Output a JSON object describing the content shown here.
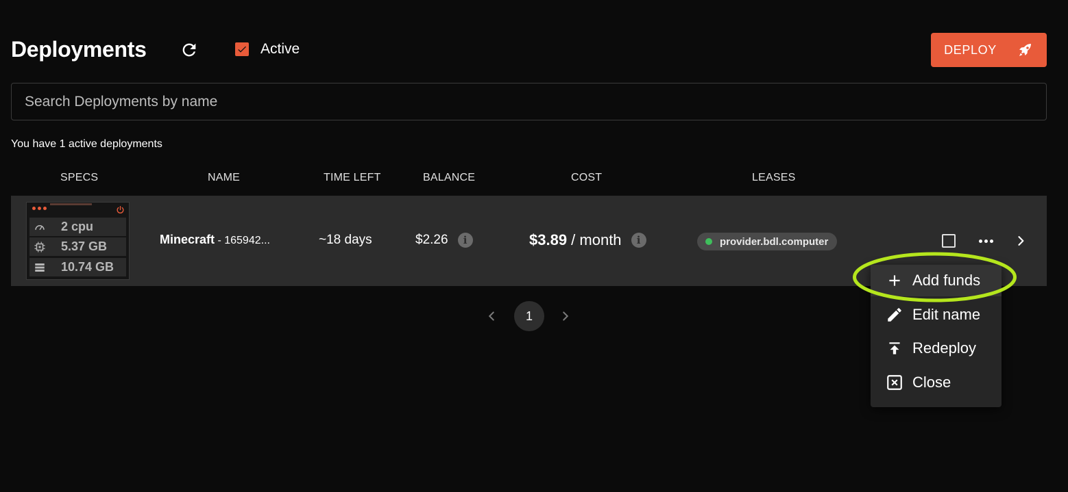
{
  "header": {
    "title": "Deployments",
    "filter_label": "Active",
    "filter_checked": true,
    "deploy_label": "DEPLOY"
  },
  "search": {
    "placeholder": "Search Deployments by name",
    "value": ""
  },
  "summary_text": "You have 1 active deployments",
  "columns": [
    "SPECS",
    "NAME",
    "TIME LEFT",
    "BALANCE",
    "COST",
    "LEASES"
  ],
  "deployment": {
    "specs": {
      "cpu": "2 cpu",
      "memory": "5.37 GB",
      "storage": "10.74 GB"
    },
    "name": "Minecraft",
    "dseq": " - 165942...",
    "time_left": "~18 days",
    "balance": "$2.26",
    "cost_amount": "$3.89",
    "cost_period": " / month",
    "lease_provider": "provider.bdl.computer",
    "lease_status_color": "#3fbf5c"
  },
  "pagination": {
    "current_page": "1"
  },
  "menu": {
    "items": [
      {
        "label": "Add funds",
        "icon": "plus-icon"
      },
      {
        "label": "Edit name",
        "icon": "pencil-icon"
      },
      {
        "label": "Redeploy",
        "icon": "upload-icon"
      },
      {
        "label": "Close",
        "icon": "close-box-icon"
      }
    ]
  },
  "colors": {
    "accent": "#e85b3a",
    "background": "#0b0b0b",
    "row": "#2c2c2c",
    "annotation": "#b5e61d"
  }
}
